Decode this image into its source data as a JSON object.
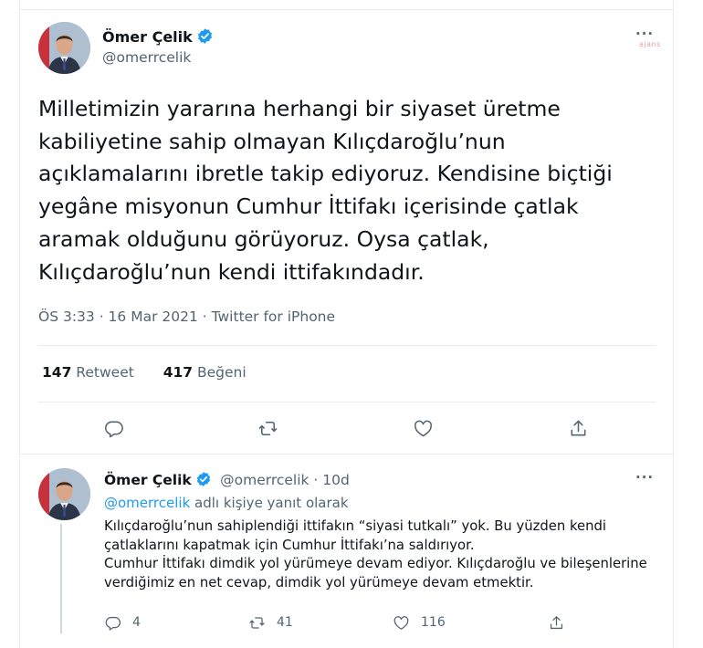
{
  "main_tweet": {
    "author_name": "Ömer Çelik",
    "author_handle": "@omerrcelik",
    "text": "Milletimizin yararına herhangi bir siyaset üretme kabiliyetine sahip olmayan Kılıçdaroğlu’nun açıklamalarını ibretle takip ediyoruz. Kendisine biçtiği yegâne misyonun Cumhur İttifakı içerisinde çatlak aramak olduğunu görüyoruz. Oysa çatlak, Kılıçdaroğlu’nun kendi ittifakındadır.",
    "timestamp": "ÖS 3:33 · 16 Mar 2021 · Twitter for iPhone",
    "retweet_count": "147",
    "retweet_label": "Retweet",
    "like_count": "417",
    "like_label": "Beğeni",
    "more_label": "···",
    "watermark": "ajans"
  },
  "reply": {
    "author_name": "Ömer Çelik",
    "author_handle": "@omerrcelik · 10d",
    "replying_handle": "@omerrcelik",
    "replying_suffix": " adlı kişiye yanıt olarak",
    "paragraph_1": "Kılıçdaroğlu’nun sahiplendiği ittifakın “siyasi tutkalı” yok. Bu yüzden kendi çatlaklarını kapatmak için Cumhur İttifakı’na saldırıyor.",
    "paragraph_2": "Cumhur İttifakı dimdik yol yürümeye devam ediyor. Kılıçdaroğlu ve bileşenlerine verdiğimiz en net cevap, dimdik yol yürümeye devam etmektir.",
    "reply_count": "4",
    "retweet_count": "41",
    "like_count": "116",
    "more_label": "···"
  },
  "colors": {
    "link": "#1d9bf0",
    "verified": "#1d9bf0",
    "secondary_text": "#536471",
    "border": "#e6ecf0"
  },
  "icons": [
    "verified-badge-icon",
    "reply-icon",
    "retweet-icon",
    "like-icon",
    "share-icon",
    "more-icon"
  ]
}
